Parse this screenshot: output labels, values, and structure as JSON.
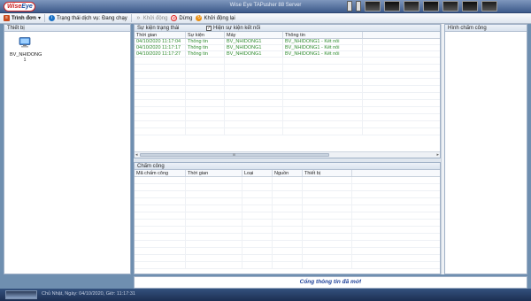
{
  "titlebar": {
    "logo_main": "Wise",
    "logo_accent": "Eye",
    "title": "Wise Eye TAPusher 88 Server"
  },
  "toolbar": {
    "menu_label": "Trình đơn",
    "menu_caret": "▾",
    "service_status_label": "Trạng thái dịch vụ:",
    "service_status_value": "Đang chạy",
    "start_label": "Khởi động",
    "stop_label": "Dừng",
    "restart_label": "Khởi động lại"
  },
  "devices_panel": {
    "title": "Thiết bị",
    "devices": [
      {
        "name": "BV_NHIDONG",
        "number": "1"
      }
    ]
  },
  "events_panel": {
    "title": "Sự kiện trạng thái",
    "show_connect_label": "Hiện sự kiện kết nối",
    "show_connect_checked": true,
    "columns": [
      "Thời gian",
      "Sự kiện",
      "Máy",
      "Thông tin"
    ],
    "rows": [
      {
        "time": "04/10/2020 11:17:04",
        "event": "Thông tin",
        "machine": "BV_NHIDONG1",
        "info": "BV_NHIDONG1 - Kết nối"
      },
      {
        "time": "04/10/2020 11:17:17",
        "event": "Thông tin",
        "machine": "BV_NHIDONG1",
        "info": "BV_NHIDONG1 - Kết nối"
      },
      {
        "time": "04/10/2020 11:17:27",
        "event": "Thông tin",
        "machine": "BV_NHIDONG1",
        "info": "BV_NHIDONG1 - Kết nối"
      }
    ],
    "scroll_mark": "III"
  },
  "attendance_panel": {
    "title": "Chấm công",
    "columns": [
      "Mã chấm công",
      "Thời gian",
      "Loại",
      "Nguồn",
      "Thiết bị"
    ],
    "rows": []
  },
  "photos_panel": {
    "title": "Hình chấm công"
  },
  "notice": {
    "text": "Cổng thông tin đã mở!"
  },
  "statusbar": {
    "text": "Chủ Nhật, Ngày: 04/10/2020, Giờ: 11:17:31"
  },
  "colors": {
    "event_text": "#2d8a2d",
    "notice_text": "#1c3f99",
    "titlebar": "#3d5a8a"
  }
}
